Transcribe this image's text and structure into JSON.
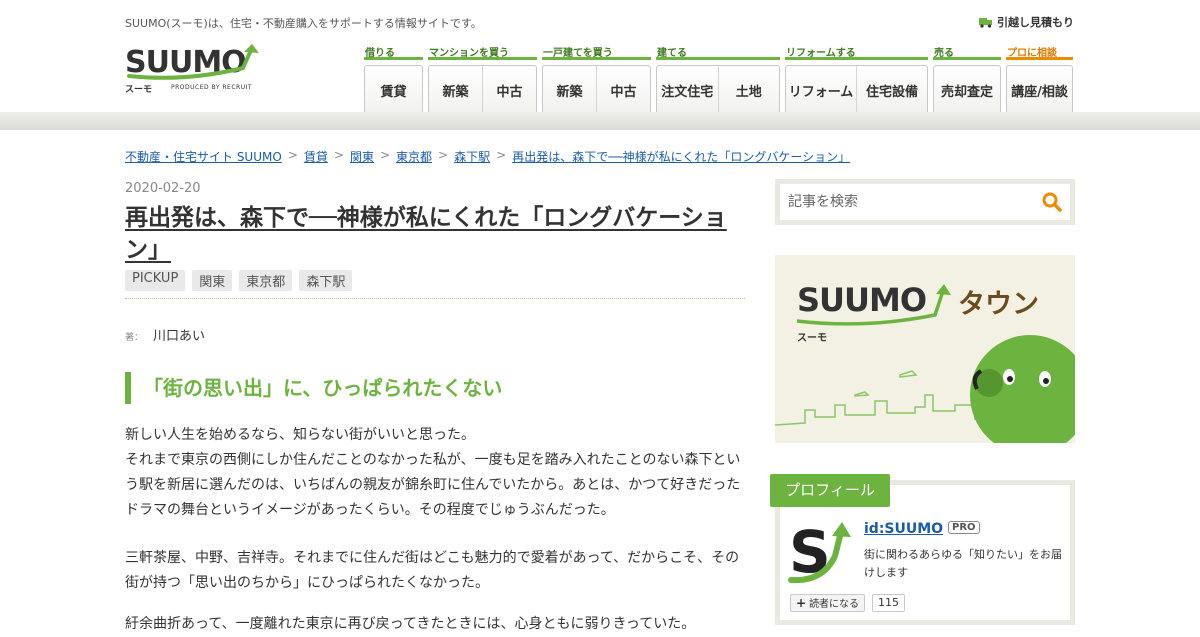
{
  "header": {
    "tagline": "SUUMO(スーモ)は、住宅・不動産購入をサポートする情報サイトです。",
    "moving_link": "引越し見積もり",
    "logo": {
      "word": "SUUMO",
      "sub": "スーモ",
      "produced": "PRODUCED BY RECRUIT"
    }
  },
  "nav": {
    "groups": [
      {
        "label": "借りる",
        "items": [
          "賃貸"
        ]
      },
      {
        "label": "マンションを買う",
        "items": [
          "新築",
          "中古"
        ]
      },
      {
        "label": "一戸建てを買う",
        "items": [
          "新築",
          "中古"
        ]
      },
      {
        "label": "建てる",
        "items": [
          "注文住宅",
          "土地"
        ]
      },
      {
        "label": "リフォームする",
        "items": [
          "リフォーム",
          "住宅設備"
        ]
      },
      {
        "label": "売る",
        "items": [
          "売却査定"
        ]
      },
      {
        "label": "プロに相談",
        "items": [
          "講座/相談"
        ]
      }
    ]
  },
  "breadcrumb": [
    "不動産・住宅サイト SUUMO",
    "賃貸",
    "関東",
    "東京都",
    "森下駅",
    "再出発は、森下で──神様が私にくれた「ロングバケーション」"
  ],
  "article": {
    "date": "2020-02-20",
    "title": "再出発は、森下で──神様が私にくれた「ロングバケーション」",
    "tags": [
      "PICKUP",
      "関東",
      "東京都",
      "森下駅"
    ],
    "author_label": "著：",
    "author": "川口あい",
    "heading": "「街の思い出」に、ひっぱられたくない",
    "paragraphs": [
      "新しい人生を始めるなら、知らない街がいいと思った。",
      "それまで東京の西側にしか住んだことのなかった私が、一度も足を踏み入れたことのない森下という駅を新居に選んだのは、いちばんの親友が錦糸町に住んでいたから。あとは、かつて好きだったドラマの舞台というイメージがあったくらい。その程度でじゅうぶんだった。",
      "三軒茶屋、中野、吉祥寺。それまでに住んだ街はどこも魅力的で愛着があって、だからこそ、その街が持つ「思い出のちから」にひっぱられたくなかった。",
      "紆余曲折あって、一度離れた東京に再び戻ってきたときには、心身ともに弱りきっていた。"
    ]
  },
  "sidebar": {
    "search_placeholder": "記事を検索",
    "banner": {
      "word": "SUUMO",
      "town": "タウン",
      "sub": "スーモ"
    },
    "profile": {
      "tab": "プロフィール",
      "id": "id:SUUMO",
      "badge": "PRO",
      "description": "街に関わるあらゆる「知りたい」をお届けします",
      "follow": "読者になる",
      "follow_count": "115"
    }
  },
  "colors": {
    "brand_green": "#6db33f",
    "orange": "#ed8b00",
    "link": "#1a5ca8"
  }
}
